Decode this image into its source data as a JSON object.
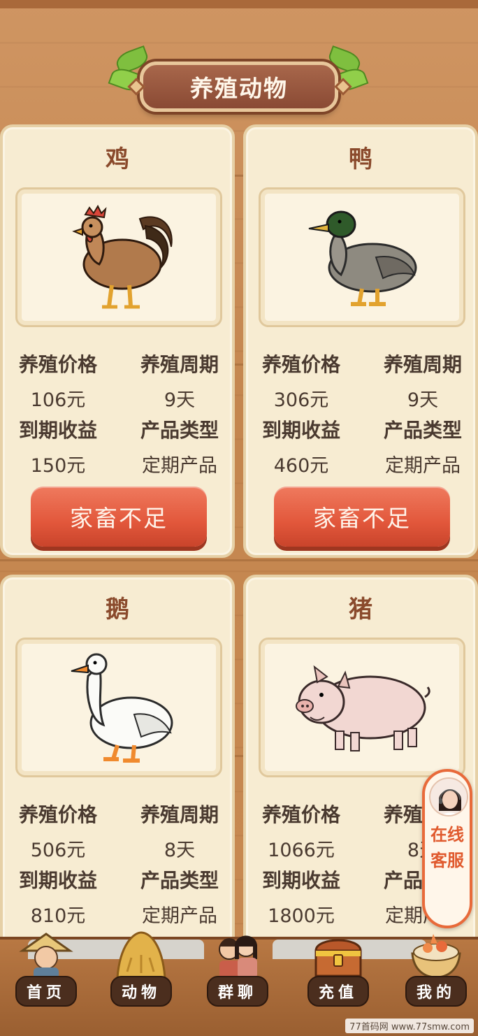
{
  "header": {
    "title": "养殖动物"
  },
  "cards": [
    {
      "name": "鸡",
      "icon": "chicken-illustration",
      "price_label": "养殖价格",
      "price": "106元",
      "cycle_label": "养殖周期",
      "cycle": "9天",
      "income_label": "到期收益",
      "income": "150元",
      "type_label": "产品类型",
      "type": "定期产品",
      "button": "家畜不足"
    },
    {
      "name": "鸭",
      "icon": "duck-illustration",
      "price_label": "养殖价格",
      "price": "306元",
      "cycle_label": "养殖周期",
      "cycle": "9天",
      "income_label": "到期收益",
      "income": "460元",
      "type_label": "产品类型",
      "type": "定期产品",
      "button": "家畜不足"
    },
    {
      "name": "鹅",
      "icon": "goose-illustration",
      "price_label": "养殖价格",
      "price": "506元",
      "cycle_label": "养殖周期",
      "cycle": "8天",
      "income_label": "到期收益",
      "income": "810元",
      "type_label": "产品类型",
      "type": "定期产品"
    },
    {
      "name": "猪",
      "icon": "pig-illustration",
      "price_label": "养殖价格",
      "price": "1066元",
      "cycle_label": "养殖周期",
      "cycle": "8天",
      "income_label": "到期收益",
      "income": "1800元",
      "type_label": "产品类型",
      "type": "定期产品"
    }
  ],
  "customer_service": {
    "label": "在线客服"
  },
  "nav": [
    {
      "label": "首页",
      "icon": "farmer-icon"
    },
    {
      "label": "动物",
      "icon": "haystack-icon"
    },
    {
      "label": "群聊",
      "icon": "group-chat-icon"
    },
    {
      "label": "充值",
      "icon": "treasure-chest-icon"
    },
    {
      "label": "我的",
      "icon": "food-bowl-icon"
    }
  ],
  "watermark": "77首码网 www.77smw.com",
  "colors": {
    "accent": "#e2573b",
    "title_text": "#8a4a2c",
    "card_bg": "#f7ecd2",
    "wood": "#c88a52"
  }
}
